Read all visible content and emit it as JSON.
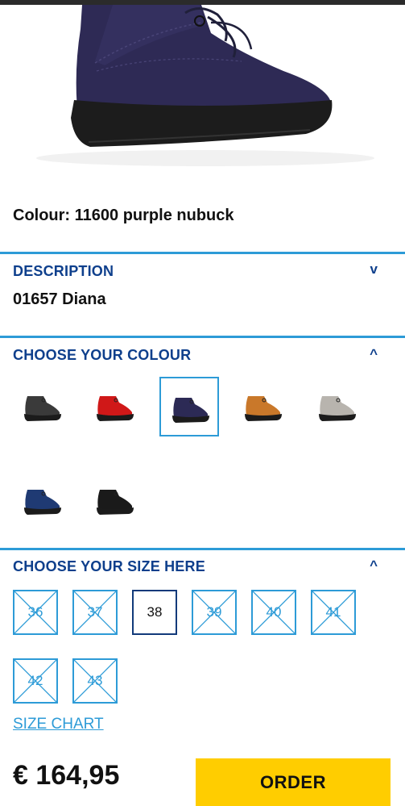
{
  "product": {
    "colour_line": "Colour: 11600 purple nubuck"
  },
  "description": {
    "title": "DESCRIPTION",
    "value": "01657 Diana",
    "chevron": "v"
  },
  "colour_section": {
    "title": "CHOOSE YOUR COLOUR",
    "chevron": "^",
    "swatches": [
      {
        "color": "#3a3a3a",
        "selected": false
      },
      {
        "color": "#d01818",
        "selected": false
      },
      {
        "color": "#2c2a55",
        "selected": true
      },
      {
        "color": "#c9782a",
        "selected": false
      },
      {
        "color": "#b8b4ae",
        "selected": false
      },
      {
        "color": "#1f3a73",
        "selected": false
      },
      {
        "color": "#1a1a1a",
        "selected": false
      }
    ]
  },
  "size_section": {
    "title": "CHOOSE YOUR SIZE HERE",
    "chevron": "^",
    "sizes": [
      {
        "label": "36",
        "available": false
      },
      {
        "label": "37",
        "available": false
      },
      {
        "label": "38",
        "available": true
      },
      {
        "label": "39",
        "available": false
      },
      {
        "label": "40",
        "available": false
      },
      {
        "label": "41",
        "available": false
      },
      {
        "label": "42",
        "available": false
      },
      {
        "label": "43",
        "available": false
      }
    ],
    "size_chart_link": "SIZE CHART"
  },
  "purchase": {
    "price": "€ 164,95",
    "order_label": "ORDER"
  },
  "colors": {
    "accent_blue": "#2d9bd7",
    "heading_blue": "#0e3f8c",
    "order_yellow": "#ffcd00"
  }
}
